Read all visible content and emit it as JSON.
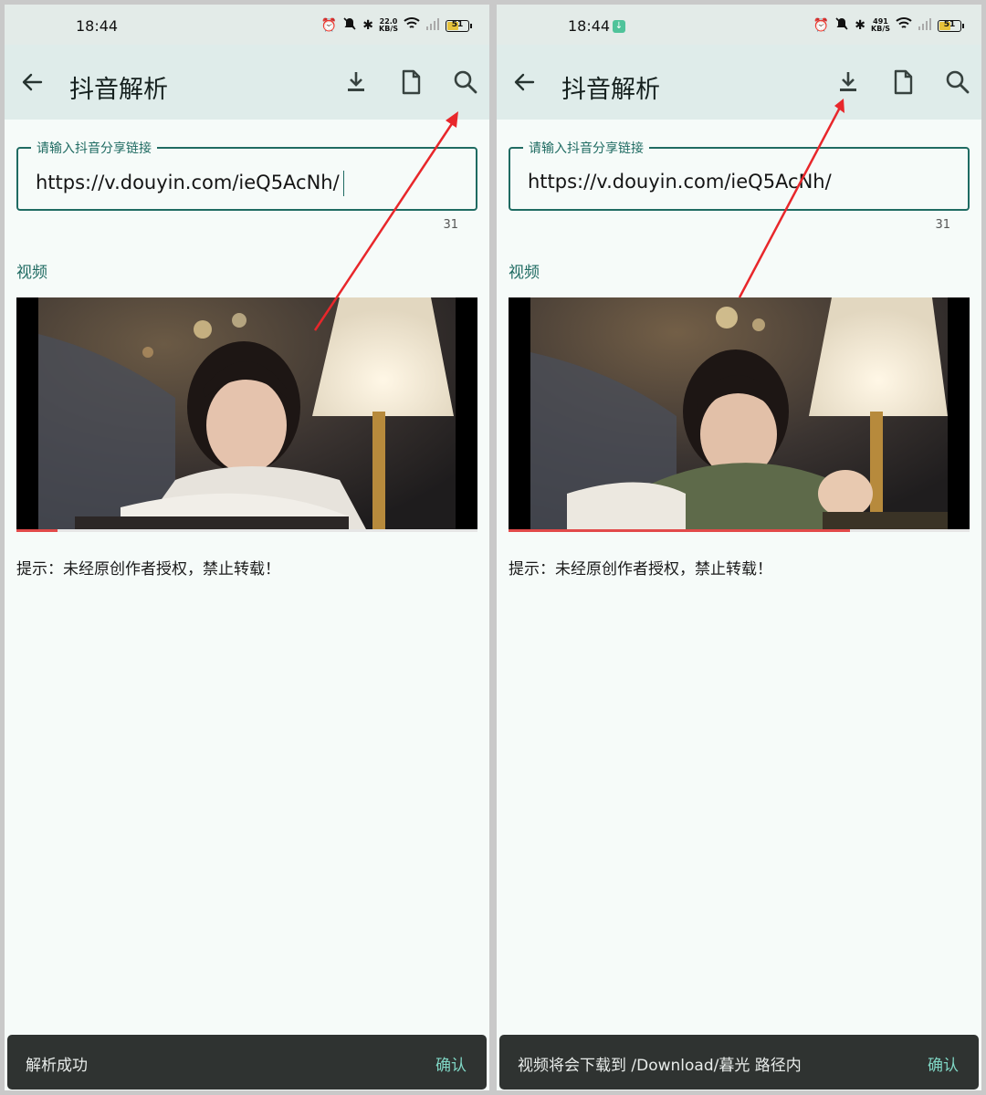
{
  "colors": {
    "accent": "#1f6b62",
    "app_bar": "#dfecea",
    "background": "#f6fbf9",
    "snackbar": "#2f3331",
    "snackbar_action": "#7fd6c4",
    "progress": "#e24a4a",
    "annotation_arrow": "#e8272b"
  },
  "screens": [
    {
      "status_bar": {
        "time": "18:44",
        "net_speed_value": "22.0",
        "net_speed_unit": "KB/S",
        "battery": "51",
        "icons": [
          "alarm-icon",
          "mute-icon",
          "bluetooth-icon",
          "wifi-icon",
          "signal-icon",
          "battery-icon"
        ]
      },
      "app_bar": {
        "title": "抖音解析",
        "actions": [
          "download-icon",
          "file-icon",
          "search-icon"
        ]
      },
      "input": {
        "label": "请输入抖音分享链接",
        "value": "https://v.douyin.com/ieQ5AcNh/",
        "char_count": "31"
      },
      "section_title": "视频",
      "video_progress": 0.09,
      "hint": "提示：未经原创作者授权，禁止转载！",
      "snackbar": {
        "message": "解析成功",
        "action": "确认"
      }
    },
    {
      "status_bar": {
        "time": "18:44",
        "net_speed_value": "491",
        "net_speed_unit": "KB/S",
        "battery": "51",
        "icons": [
          "download-indicator-icon",
          "alarm-icon",
          "mute-icon",
          "bluetooth-icon",
          "wifi-icon",
          "signal-icon",
          "battery-icon"
        ]
      },
      "app_bar": {
        "title": "抖音解析",
        "actions": [
          "download-icon",
          "file-icon",
          "search-icon"
        ]
      },
      "input": {
        "label": "请输入抖音分享链接",
        "value": "https://v.douyin.com/ieQ5AcNh/",
        "char_count": "31"
      },
      "section_title": "视频",
      "video_progress": 0.74,
      "hint": "提示：未经原创作者授权，禁止转载！",
      "snackbar": {
        "message": "视频将会下载到 /Download/暮光 路径内",
        "action": "确认"
      }
    }
  ]
}
